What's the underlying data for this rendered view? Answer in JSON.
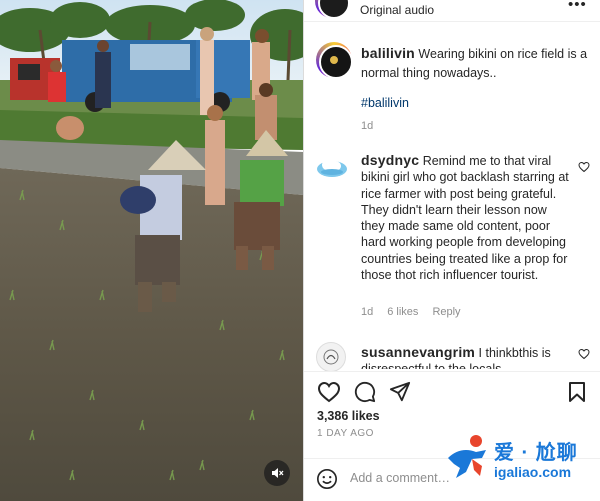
{
  "header": {
    "audio_label": "Original audio",
    "more_icon": "more-horizontal-icon"
  },
  "post": {
    "username": "balilivin",
    "caption": "Wearing bikini on rice field is a normal thing nowadays..",
    "hashtag": "#balilivin",
    "age": "1d"
  },
  "comments": [
    {
      "username": "dsydnyc",
      "text": "Remind me to that viral bikini girl who got backlash starring at rice farmer with post being grateful. They didn't learn their lesson now they made same old content, poor hard working people from developing countries being treated like a prop for those thot rich influencer tourist.",
      "age": "1d",
      "likes": "6 likes",
      "reply_label": "Reply"
    },
    {
      "username": "susannevangrim",
      "text": "I thinkbthis is disrespectful to the locals"
    }
  ],
  "stats": {
    "likes": "3,386 likes",
    "date": "1 DAY AGO"
  },
  "add_comment": {
    "placeholder": "Add a comment…"
  },
  "watermark": {
    "text": "爱 · 尬聊",
    "url": "igaliao.com"
  },
  "colors": {
    "link": "#00376b",
    "muted": "#8e8e8e",
    "text": "#262626",
    "watermark": "#1a78d8"
  }
}
